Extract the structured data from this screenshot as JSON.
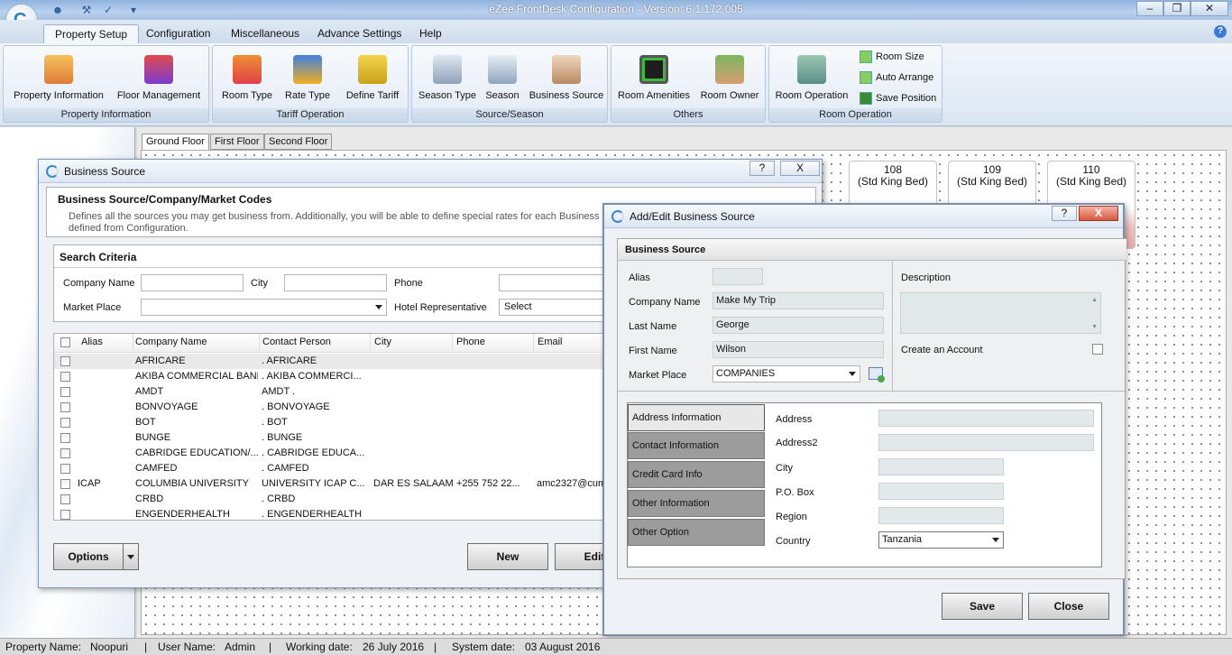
{
  "app": {
    "title": "eZee FrontDesk Configuration - Version: 6.1.172.005",
    "help_glyph": "?",
    "quick_access": [
      "user-icon",
      "tools-icon",
      "spellcheck-icon",
      "dropdown-icon"
    ]
  },
  "menu": {
    "tabs": [
      {
        "label": "Property Setup"
      },
      {
        "label": "Configuration"
      },
      {
        "label": "Miscellaneous"
      },
      {
        "label": "Advance Settings"
      },
      {
        "label": "Help"
      }
    ]
  },
  "ribbon": {
    "groups": [
      {
        "label": "Property Information",
        "buttons": [
          "Property Information",
          "Floor Management"
        ]
      },
      {
        "label": "Tariff Operation",
        "buttons": [
          "Room Type",
          "Rate Type",
          "Define Tariff"
        ]
      },
      {
        "label": "Source/Season",
        "buttons": [
          "Season Type",
          "Season",
          "Business Source"
        ]
      },
      {
        "label": "Others",
        "buttons": [
          "Room Amenities",
          "Room Owner"
        ]
      },
      {
        "label": "Room Operation",
        "buttons": [
          "Room Operation",
          "Room Size",
          "Auto Arrange",
          "Save Position"
        ]
      }
    ]
  },
  "floors": {
    "tabs": [
      "Ground Floor",
      "First Floor",
      "Second Floor"
    ],
    "rooms": [
      {
        "number": "108",
        "type": "(Std King Bed)"
      },
      {
        "number": "109",
        "type": "(Std King Bed)"
      },
      {
        "number": "110",
        "type": "(Std King Bed)"
      }
    ]
  },
  "business_source_dialog": {
    "title": "Business Source",
    "help": "?",
    "close": "X",
    "header": "Business Source/Company/Market Codes",
    "description": "Defines all the sources you may get business from. Additionally, you will be able to define special rates for each Business So",
    "description2": "defined from Configuration.",
    "search_title": "Search Criteria",
    "labels": {
      "company_name": "Company Name",
      "city": "City",
      "phone": "Phone",
      "market_place": "Market Place",
      "hotel_rep": "Hotel Representative"
    },
    "hotel_rep_value": "Select",
    "columns": [
      "Alias",
      "Company Name",
      "Contact Person",
      "City",
      "Phone",
      "Email"
    ],
    "rows": [
      {
        "alias": "",
        "company": "AFRICARE",
        "contact": ". AFRICARE",
        "city": "",
        "phone": "",
        "email": ""
      },
      {
        "alias": "",
        "company": "AKIBA COMMERCIAL BANK",
        "contact": ". AKIBA COMMERCI...",
        "city": "",
        "phone": "",
        "email": ""
      },
      {
        "alias": "",
        "company": "AMDT",
        "contact": "AMDT .",
        "city": "",
        "phone": "",
        "email": ""
      },
      {
        "alias": "",
        "company": "BONVOYAGE",
        "contact": ". BONVOYAGE",
        "city": "",
        "phone": "",
        "email": ""
      },
      {
        "alias": "",
        "company": "BOT",
        "contact": ". BOT",
        "city": "",
        "phone": "",
        "email": ""
      },
      {
        "alias": "",
        "company": "BUNGE",
        "contact": ". BUNGE",
        "city": "",
        "phone": "",
        "email": ""
      },
      {
        "alias": "",
        "company": "CABRIDGE EDUCATION/...",
        "contact": ". CABRIDGE EDUCA...",
        "city": "",
        "phone": "",
        "email": ""
      },
      {
        "alias": "",
        "company": "CAMFED",
        "contact": ". CAMFED",
        "city": "",
        "phone": "",
        "email": ""
      },
      {
        "alias": "ICAP",
        "company": "COLUMBIA UNIVERSITY",
        "contact": "UNIVERSITY ICAP C...",
        "city": "DAR ES SALAAM",
        "phone": "+255 752 22...",
        "email": "amc2327@cum"
      },
      {
        "alias": "",
        "company": "CRBD",
        "contact": ". CRBD",
        "city": "",
        "phone": "",
        "email": ""
      },
      {
        "alias": "",
        "company": "ENGENDERHEALTH",
        "contact": ". ENGENDERHEALTH",
        "city": "",
        "phone": "",
        "email": ""
      }
    ],
    "buttons": {
      "options": "Options",
      "new": "New",
      "edit": "Edit"
    }
  },
  "add_edit_dialog": {
    "title": "Add/Edit Business Source",
    "help": "?",
    "close": "X",
    "section_title": "Business Source",
    "labels": {
      "alias": "Alias",
      "company_name": "Company Name",
      "last_name": "Last Name",
      "first_name": "First Name",
      "market_place": "Market Place",
      "description": "Description",
      "create_account": "Create an Account"
    },
    "values": {
      "alias": "",
      "company_name": "Make My Trip",
      "last_name": "George",
      "first_name": "Wilson",
      "market_place": "COMPANIES"
    },
    "side_tabs": [
      "Address Information",
      "Contact Information",
      "Credit Card Info",
      "Other Information",
      "Other Option"
    ],
    "address_labels": {
      "address": "Address",
      "address2": "Address2",
      "city": "City",
      "po_box": "P.O. Box",
      "region": "Region",
      "country": "Country"
    },
    "country_value": "Tanzania",
    "buttons": {
      "save": "Save",
      "close": "Close"
    }
  },
  "status_bar": {
    "property_label": "Property Name:",
    "property_value": "Noopuri",
    "user_label": "User Name:",
    "user_value": "Admin",
    "working_label": "Working date:",
    "working_value": "26 July 2016",
    "system_label": "System date:",
    "system_value": "03 August 2016"
  }
}
